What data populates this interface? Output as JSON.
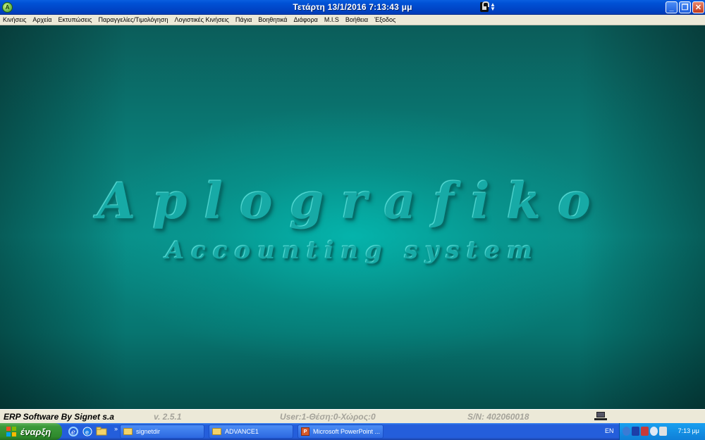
{
  "titlebar": {
    "app_icon_label": "A",
    "title": "Τετάρτη  13/1/2016 7:13:43 μμ",
    "controls": {
      "minimize": "_",
      "maximize": "❐",
      "close": "✕"
    }
  },
  "menu": {
    "items": [
      "Κινήσεις",
      "Αρχεία",
      "Εκτυπώσεις",
      "Παραγγελίες/Τιμολόγηση",
      "Λογιστικές Κινήσεις",
      "Πάγια",
      "Βοηθητικά",
      "Διάφορα",
      "M.I.S",
      "Βοήθεια",
      "Έξοδος"
    ]
  },
  "main": {
    "logo_title": "Aplografiko",
    "logo_subtitle": "Accounting system",
    "colors": {
      "background": "#0a8e88",
      "logo": "#17aaa6"
    }
  },
  "status": {
    "company": "ERP Software By Signet s.a",
    "version": "v. 2.5.1",
    "user": "User:1-Θέση:0-Χώρος:0",
    "serial": "S/N: 402060018"
  },
  "taskbar": {
    "start_label": "έναρξη",
    "quick_launch_more": "»",
    "tasks": [
      "signetdir",
      "ADVANCE1",
      "Microsoft PowerPoint ..."
    ],
    "language": "EN",
    "clock": "7:13 μμ"
  },
  "icons": {
    "app": "app-icon",
    "lock": "lock-icon",
    "computer": "computer-icon",
    "start": "windows-flag-icon",
    "folder": "folder-icon",
    "powerpoint": "powerpoint-icon"
  }
}
